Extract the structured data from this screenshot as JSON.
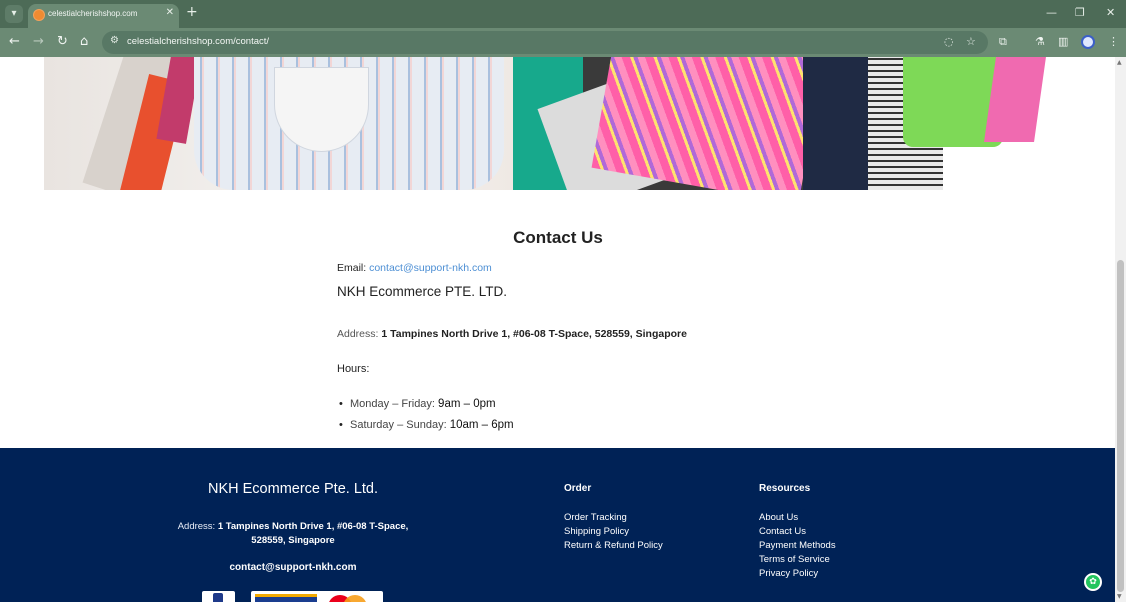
{
  "browser": {
    "tab_title": "celestialcherishshop.com",
    "url": "celestialcherishshop.com/contact/",
    "icons": {
      "tab_menu": "▾",
      "tab_close": "✕",
      "new_tab": "+",
      "minimize": "—",
      "restore": "❐",
      "close": "✕",
      "back": "←",
      "forward": "→",
      "reload": "↻",
      "home": "⌂",
      "site_info": "⚙",
      "eye_off": "◌",
      "star": "☆",
      "extensions": "⧉",
      "labs": "⚗",
      "sidebar": "▥",
      "menu": "⋮"
    }
  },
  "contact": {
    "title": "Contact Us",
    "email_label": "Email: ",
    "email": "contact@support-nkh.com",
    "company": "NKH Ecommerce PTE. LTD.",
    "address_label": "Address: ",
    "address": "1 Tampines North Drive 1, #06-08 T-Space, 528559, Singapore",
    "hours_label": "Hours:",
    "hours": [
      {
        "days": "Monday – Friday: ",
        "time": "9am – 0pm"
      },
      {
        "days": "Saturday – Sunday: ",
        "time": "10am – 6pm"
      }
    ]
  },
  "footer": {
    "company": "NKH Ecommerce Pte. Ltd.",
    "address_label": "Address: ",
    "address": "1 Tampines North Drive 1, #06-08 T-Space, 528559, Singapore",
    "email": "contact@support-nkh.com",
    "order": {
      "title": "Order",
      "links": [
        "Order Tracking",
        "Shipping Policy",
        "Return & Refund Policy"
      ]
    },
    "resources": {
      "title": "Resources",
      "links": [
        "About Us",
        "Contact Us",
        "Payment Methods",
        "Terms of Service",
        "Privacy Policy"
      ]
    }
  },
  "chat_icon": "✿",
  "colors": {
    "chrome": "#4d6b57",
    "link": "#4d8fd4",
    "footer_bg": "#002256"
  }
}
